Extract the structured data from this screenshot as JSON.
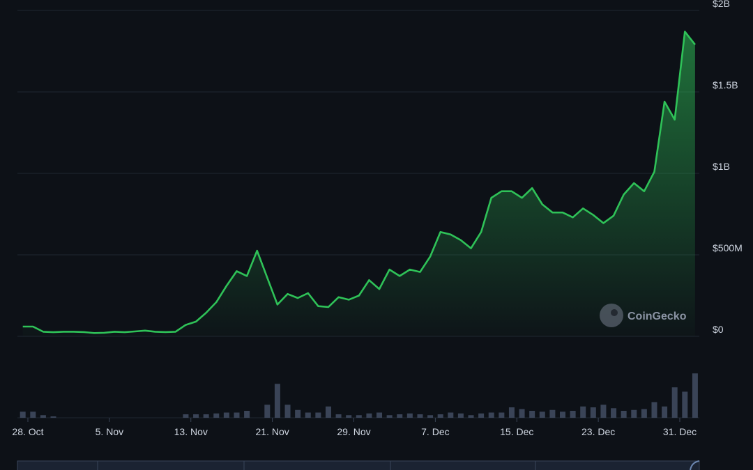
{
  "watermark": {
    "text": "CoinGecko",
    "icon": "coingecko-logo-icon"
  },
  "colors": {
    "background": "#0d1117",
    "line": "#2fc258",
    "volume": "#3a4457",
    "grid": "#1f2630"
  },
  "chart_data": {
    "type": "area",
    "xlabel": "",
    "ylabel": "",
    "ylim": [
      0,
      2000000000
    ],
    "y_ticks": [
      {
        "value": 0,
        "label": "$0"
      },
      {
        "value": 500000000,
        "label": "$500M"
      },
      {
        "value": 1000000000,
        "label": "$1B"
      },
      {
        "value": 1500000000,
        "label": "$1.5B"
      },
      {
        "value": 2000000000,
        "label": "$2B"
      }
    ],
    "x_ticks": [
      {
        "day": 0,
        "label": "28. Oct"
      },
      {
        "day": 8,
        "label": "5. Nov"
      },
      {
        "day": 16,
        "label": "13. Nov"
      },
      {
        "day": 24,
        "label": "21. Nov"
      },
      {
        "day": 32,
        "label": "29. Nov"
      },
      {
        "day": 40,
        "label": "7. Dec"
      },
      {
        "day": 48,
        "label": "15. Dec"
      },
      {
        "day": 56,
        "label": "23. Dec"
      },
      {
        "day": 64,
        "label": "31. Dec"
      }
    ],
    "grid": true,
    "legend": "none",
    "series": [
      {
        "x": [
          -0.5,
          0.5,
          1.5,
          2.5,
          3.5,
          4.5,
          5.5,
          6.5,
          7.5,
          8.5,
          9.5,
          10.5,
          11.5,
          12.5,
          13.5,
          14.5,
          15.5,
          16.5,
          17.5,
          18.5,
          19.5,
          20.5,
          21.5,
          22.5,
          23.5,
          24.5,
          25.5,
          26.5,
          27.5,
          28.5,
          29.5,
          30.5,
          31.5,
          32.5,
          33.5,
          34.5,
          35.5,
          36.5,
          37.5,
          38.5,
          39.5,
          40.5,
          41.5,
          42.5,
          43.5,
          44.5,
          45.5,
          46.5,
          47.5,
          48.5,
          49.5,
          50.5,
          51.5,
          52.5,
          53.5,
          54.5,
          55.5,
          56.5,
          57.5,
          58.5,
          59.5,
          60.5,
          61.5,
          62.5,
          63.5,
          64.5,
          65.5
        ],
        "values": [
          60,
          60,
          28,
          25,
          28,
          28,
          26,
          20,
          22,
          28,
          25,
          30,
          35,
          28,
          26,
          28,
          70,
          90,
          145,
          210,
          310,
          400,
          370,
          525,
          360,
          195,
          260,
          235,
          265,
          185,
          180,
          240,
          225,
          250,
          345,
          290,
          410,
          370,
          410,
          395,
          490,
          640,
          625,
          590,
          540,
          640,
          850,
          890,
          890,
          850,
          910,
          810,
          760,
          760,
          730,
          785,
          745,
          695,
          740,
          870,
          940,
          890,
          1010,
          1440,
          1330,
          1870,
          1790
        ]
      }
    ],
    "volume": [
      35,
      35,
      15,
      8,
      0,
      0,
      0,
      0,
      0,
      0,
      0,
      0,
      0,
      0,
      0,
      0,
      20,
      20,
      20,
      25,
      30,
      30,
      40,
      0,
      75,
      195,
      75,
      45,
      30,
      30,
      65,
      20,
      15,
      15,
      25,
      30,
      15,
      20,
      25,
      20,
      15,
      20,
      30,
      25,
      15,
      25,
      30,
      30,
      60,
      50,
      40,
      35,
      45,
      35,
      40,
      65,
      60,
      75,
      55,
      40,
      45,
      50,
      90,
      65,
      175,
      150,
      255
    ]
  }
}
